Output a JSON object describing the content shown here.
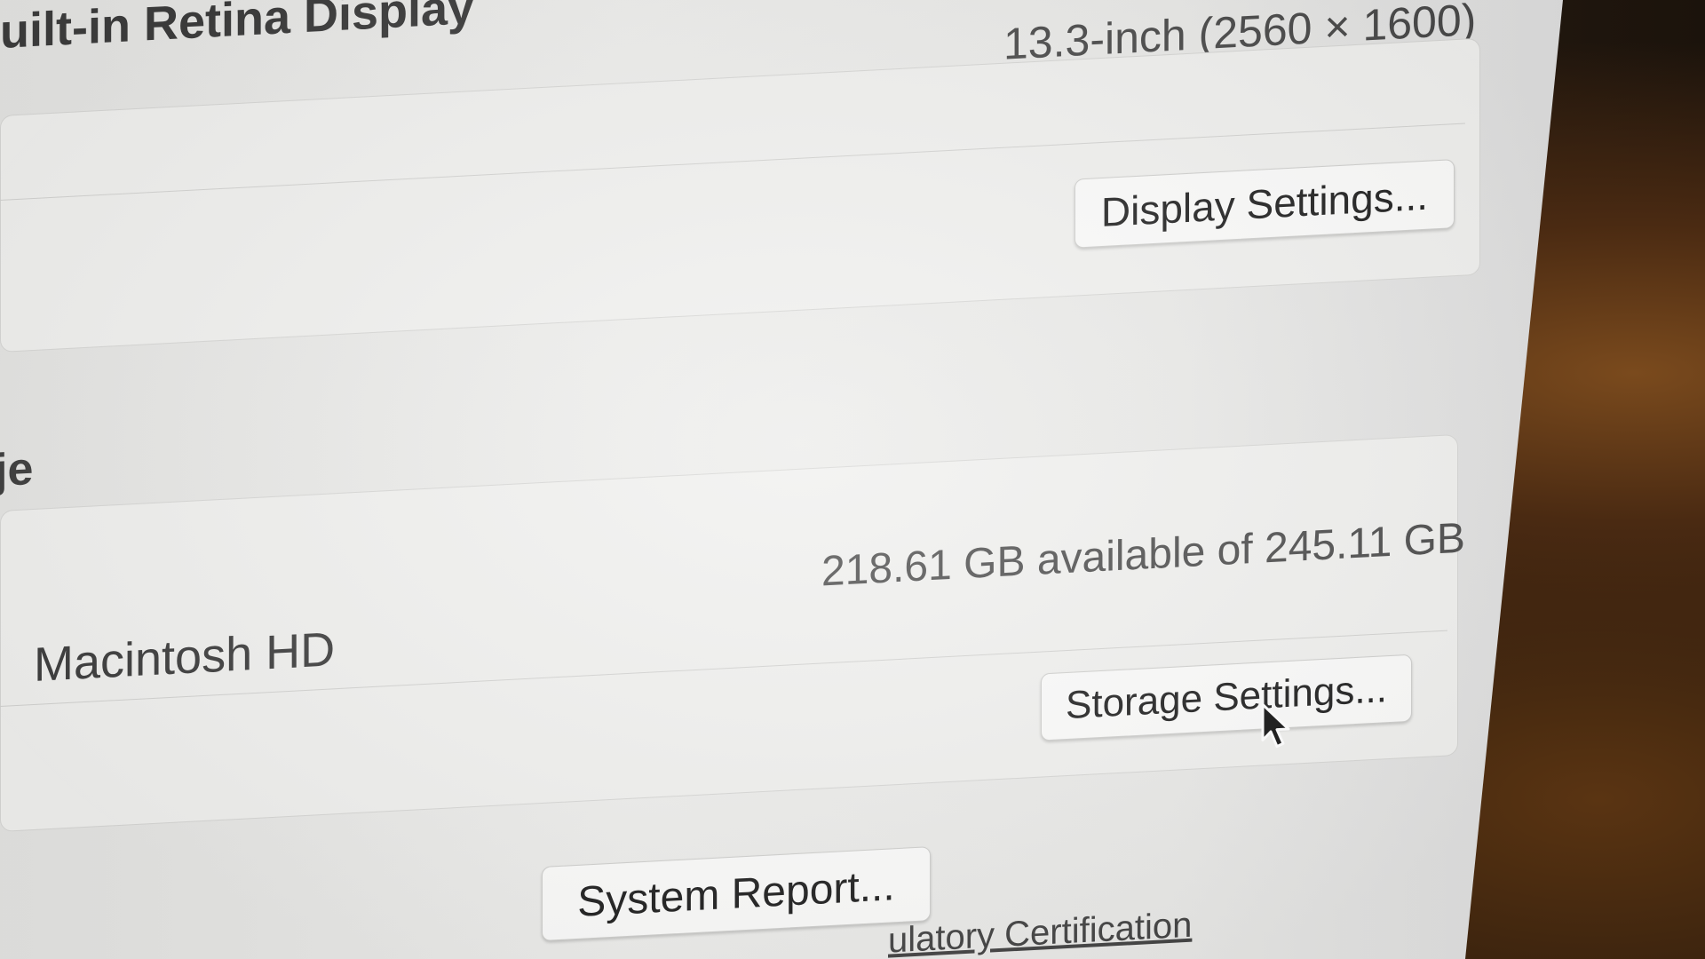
{
  "display": {
    "name": "uilt-in Retina Display",
    "spec": "13.3-inch (2560 × 1600)",
    "settings_button": "Display Settings..."
  },
  "storage": {
    "section_title_fragment": "je",
    "volume_name": "Macintosh HD",
    "availability": "218.61 GB available of 245.11 GB",
    "settings_button": "Storage Settings..."
  },
  "footer": {
    "system_report_button": "System Report...",
    "regulatory_link": "ulatory Certification"
  },
  "icons": {
    "cursor": "mouse-pointer-icon"
  },
  "colors": {
    "panel": "#ededeb",
    "button": "#fbfbfa",
    "text": "#3c3c3c"
  }
}
